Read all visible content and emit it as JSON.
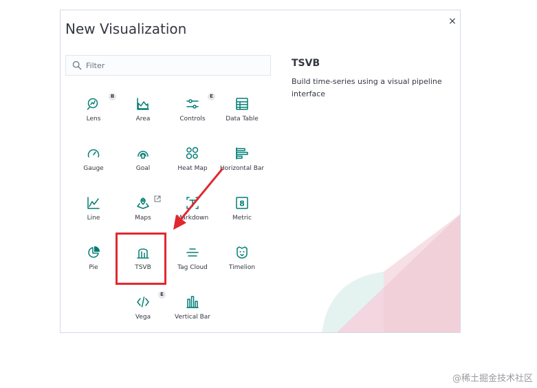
{
  "modal": {
    "title": "New Visualization",
    "close_symbol": "×",
    "filter": {
      "placeholder": "Filter",
      "value": ""
    }
  },
  "visualizations": [
    {
      "label": "Lens",
      "icon": "lens-icon",
      "badge": "B"
    },
    {
      "label": "Area",
      "icon": "area-chart-icon"
    },
    {
      "label": "Controls",
      "icon": "controls-icon",
      "badge": "E"
    },
    {
      "label": "Data Table",
      "icon": "data-table-icon"
    },
    {
      "label": "Gauge",
      "icon": "gauge-icon"
    },
    {
      "label": "Goal",
      "icon": "goal-icon"
    },
    {
      "label": "Heat Map",
      "icon": "heat-map-icon"
    },
    {
      "label": "Horizontal Bar",
      "icon": "horizontal-bar-icon"
    },
    {
      "label": "Line",
      "icon": "line-chart-icon"
    },
    {
      "label": "Maps",
      "icon": "maps-icon",
      "external": true
    },
    {
      "label": "Markdown",
      "icon": "markdown-icon"
    },
    {
      "label": "Metric",
      "icon": "metric-icon"
    },
    {
      "label": "Pie",
      "icon": "pie-chart-icon"
    },
    {
      "label": "TSVB",
      "icon": "tsvb-icon",
      "highlighted": true
    },
    {
      "label": "Tag Cloud",
      "icon": "tag-cloud-icon"
    },
    {
      "label": "Timelion",
      "icon": "timelion-icon"
    },
    {
      "label": "Vega",
      "icon": "vega-icon",
      "badge": "E"
    },
    {
      "label": "Vertical Bar",
      "icon": "vertical-bar-icon"
    }
  ],
  "description": {
    "title": "TSVB",
    "text": "Build time-series using a visual pipeline interface"
  },
  "colors": {
    "icon": "#017d73",
    "highlight": "#e0282f",
    "arrow": "#e0282f"
  },
  "watermark": "@稀土掘金技术社区"
}
